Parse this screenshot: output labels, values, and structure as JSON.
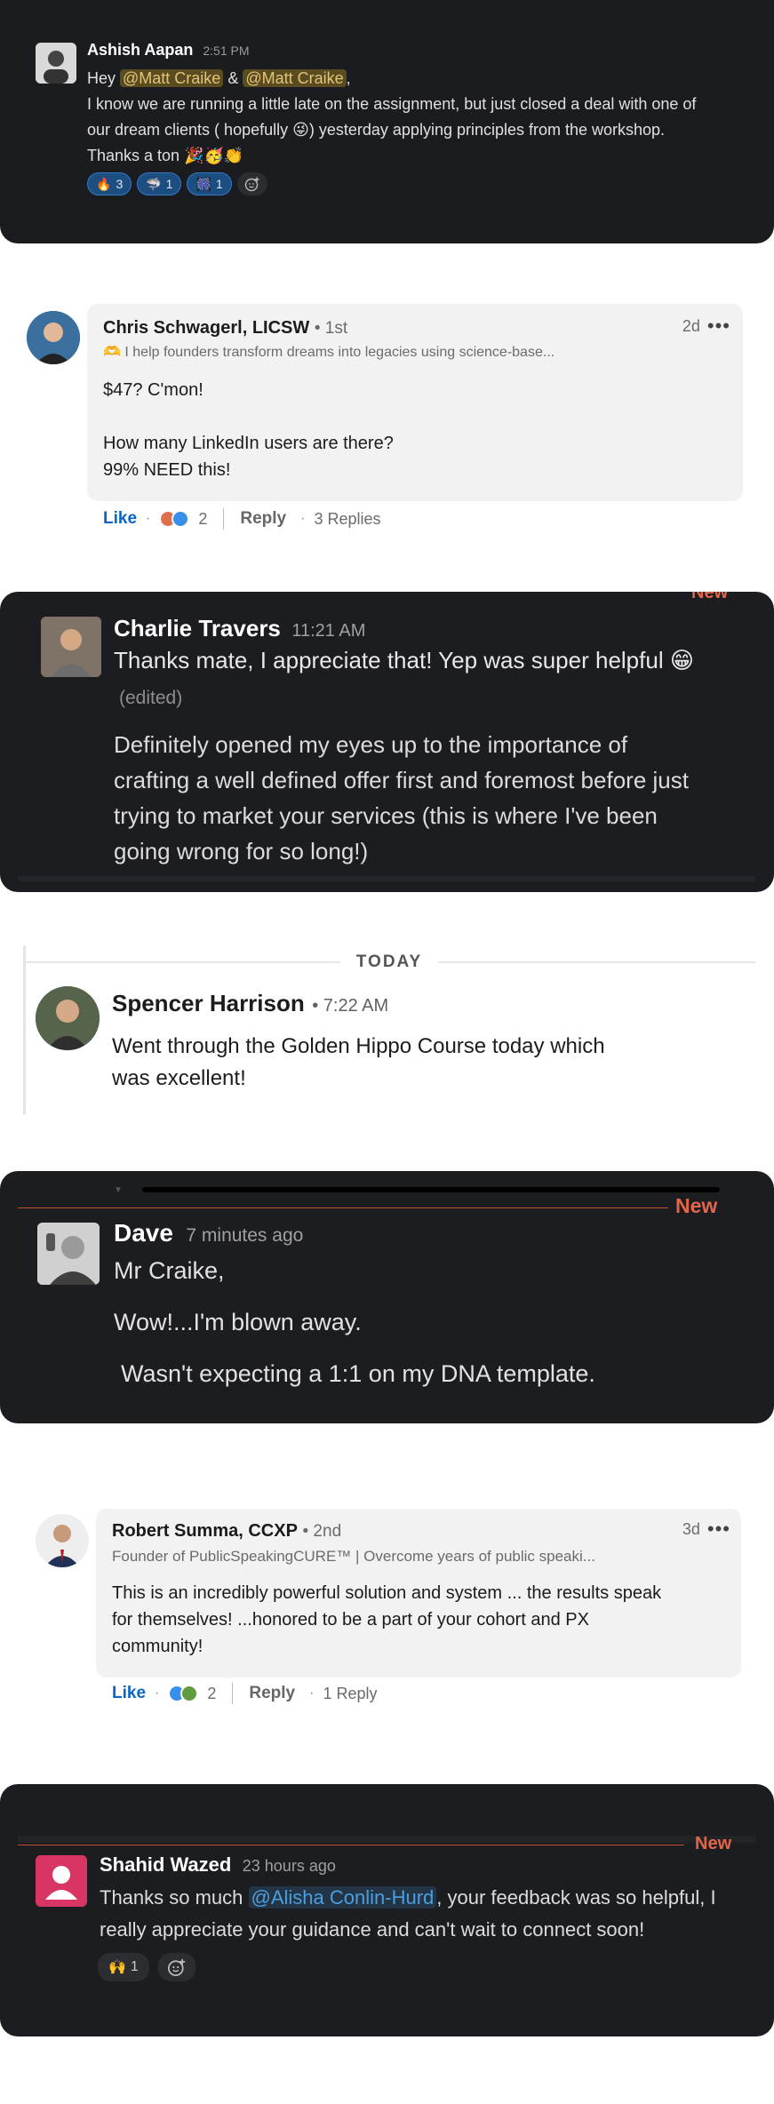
{
  "block1": {
    "name": "Ashish Aapan",
    "time": "2:51 PM",
    "hey": "Hey ",
    "mention1": "@Matt Craike",
    "amp": " & ",
    "mention2": "@Matt Craike",
    "comma": ",",
    "line2": "I know we are running a little late on the assignment, but just closed a deal with one of",
    "line3a": "our dream clients ( hopefully ",
    "line3emoji": "😜",
    "line3b": ") yesterday applying principles from the workshop.",
    "line4": "Thanks a ton",
    "line4emoji": "🎉🥳👏",
    "reactions": [
      {
        "emoji": "🔥",
        "count": "3"
      },
      {
        "emoji": "🦈",
        "count": "1"
      },
      {
        "emoji": "🎆",
        "count": "1"
      }
    ],
    "add_reaction_icon": "add-emoji-icon"
  },
  "block2": {
    "name": "Chris Schwagerl, LICSW",
    "degree": "• 1st",
    "age": "2d",
    "headline_emoji": "🫶",
    "headline": "I help founders transform dreams into legacies using science-base...",
    "body1": "$47? C'mon!",
    "body2": "How many LinkedIn users are there?",
    "body3": "99% NEED this!",
    "like": "Like",
    "reaction_count": "2",
    "reply": "Reply",
    "replies": "3 Replies"
  },
  "block3": {
    "new": "New",
    "name": "Charlie Travers",
    "time": "11:21 AM",
    "line1": "Thanks mate, I appreciate that! Yep was super helpful",
    "line1emoji": "😁",
    "edited": "(edited)",
    "para": [
      "Definitely opened my eyes up to the importance of",
      "crafting a well defined offer first and foremost before just",
      "trying to market your services (this is where I've been",
      "going wrong for so long!)"
    ]
  },
  "block4": {
    "divider": "TODAY",
    "name": "Spencer Harrison",
    "time": "• 7:22 AM",
    "line1": "Went through the Golden Hippo Course today which",
    "line2": "was excellent!"
  },
  "block5": {
    "new": "New",
    "name": "Dave",
    "time": "7 minutes ago",
    "line1": "Mr Craike,",
    "line2": "Wow!...I'm blown away.",
    "line3": "Wasn't expecting a 1:1 on my DNA template."
  },
  "block6": {
    "name": "Robert Summa, CCXP",
    "degree": "• 2nd",
    "age": "3d",
    "headline": "Founder of PublicSpeakingCURE™ | Overcome years of public speaki...",
    "line1": "This is an incredibly powerful solution and system ... the results speak",
    "line2": "for themselves! ...honored to be a part of your cohort and PX",
    "line3": "community!",
    "like": "Like",
    "reaction_count": "2",
    "reply": "Reply",
    "replies": "1 Reply"
  },
  "block7": {
    "new": "New",
    "name": "Shahid Wazed",
    "time": "23 hours ago",
    "line1a": "Thanks so much ",
    "mention": "@Alisha Conlin-Hurd",
    "line1b": ", your feedback was so helpful, I",
    "line2": "really appreciate your guidance and can't wait to connect soon!",
    "reaction_emoji": "🙌",
    "reaction_count": "1"
  }
}
